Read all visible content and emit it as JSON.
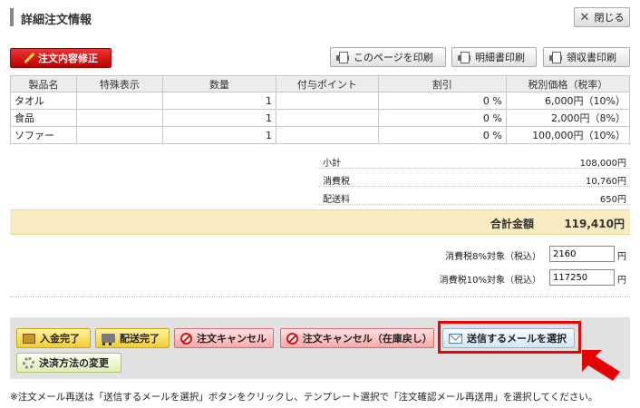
{
  "header": {
    "title": "詳細注文情報",
    "close_label": "閉じる"
  },
  "toolbar": {
    "edit_label": "注文内容修正",
    "print_page_label": "このページを印刷",
    "print_statement_label": "明細書印刷",
    "print_receipt_label": "領収書印刷"
  },
  "table": {
    "headers": [
      "製品名",
      "特殊表示",
      "数量",
      "付与ポイント",
      "割引",
      "税別価格（税率）"
    ],
    "rows": [
      {
        "name": "タオル",
        "special": "",
        "qty": "1",
        "points": "",
        "discount": "0 %",
        "price": "6,000円（10%）"
      },
      {
        "name": "食品",
        "special": "",
        "qty": "1",
        "points": "",
        "discount": "0 %",
        "price": "2,000円（8%）"
      },
      {
        "name": "ソファー",
        "special": "",
        "qty": "1",
        "points": "",
        "discount": "0 %",
        "price": "100,000円（10%）"
      }
    ]
  },
  "summary": {
    "subtotal_label": "小計",
    "subtotal": "108,000円",
    "tax_label": "消費税",
    "tax": "10,760円",
    "shipping_label": "配送料",
    "shipping": "650円"
  },
  "total": {
    "label": "合計金額",
    "value": "119,410円"
  },
  "tax_breakdown": {
    "tax8_label": "消費税8%対象（税込）",
    "tax8_value": "2160",
    "tax10_label": "消費税10%対象（税込）",
    "tax10_value": "117250",
    "unit": "円"
  },
  "actions": {
    "payment_complete": "入金完了",
    "shipping_complete": "配送完了",
    "cancel_order": "注文キャンセル",
    "cancel_order_restock": "注文キャンセル（在庫戻し）",
    "select_mail": "送信するメールを選択",
    "change_payment": "決済方法の変更"
  },
  "footnote": "※注文メール再送は「送信するメールを選択」ボタンをクリックし、テンプレート選択で「注文確認メール再送用」を選択してください。",
  "colors": {
    "highlight": "#e00000",
    "edit_button": "#cc1111",
    "total_bar": "#f7ebc2"
  }
}
